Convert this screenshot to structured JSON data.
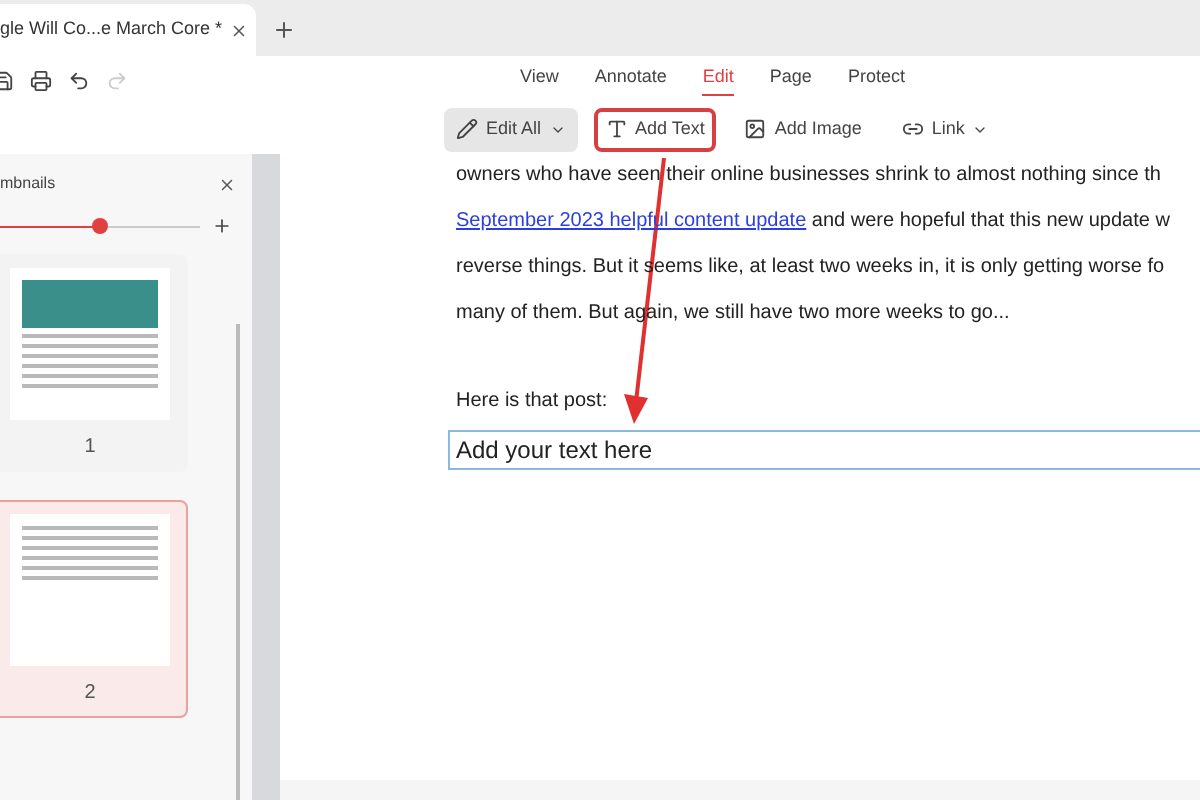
{
  "tabs": [
    {
      "label": "gle Will Co...e March Core *",
      "selected": true
    }
  ],
  "menu": [
    {
      "label": "View",
      "selected": false
    },
    {
      "label": "Annotate",
      "selected": false
    },
    {
      "label": "Edit",
      "selected": true
    },
    {
      "label": "Page",
      "selected": false
    },
    {
      "label": "Protect",
      "selected": false
    }
  ],
  "tools": [
    {
      "kind": "edit",
      "label": "Edit All",
      "selected": true,
      "highlighted": false
    },
    {
      "kind": "text",
      "label": "Add Text",
      "selected": false,
      "highlighted": true
    },
    {
      "kind": "image",
      "label": "Add Image",
      "selected": false,
      "highlighted": false
    },
    {
      "kind": "link",
      "label": "Link",
      "selected": false,
      "highlighted": false
    }
  ],
  "sidebar": {
    "title": "mbnails",
    "level": 0.5,
    "pages": [
      {
        "label": "1",
        "selected": false
      },
      {
        "label": "2",
        "selected": true
      }
    ]
  },
  "document": {
    "lines": [
      {
        "text": "owners who have seen their online businesses shrink to almost nothing since th"
      },
      {
        "link": "September 2023 helpful content update",
        "text": " and were hopeful that this new update w"
      },
      {
        "text": "reverse things. But it seems like, at least two weeks in, it is only getting worse fo"
      },
      {
        "text": "many of them. But again, we still have two more weeks to go..."
      }
    ],
    "heading": "Here is that post:",
    "text_box": "Add your text here"
  }
}
